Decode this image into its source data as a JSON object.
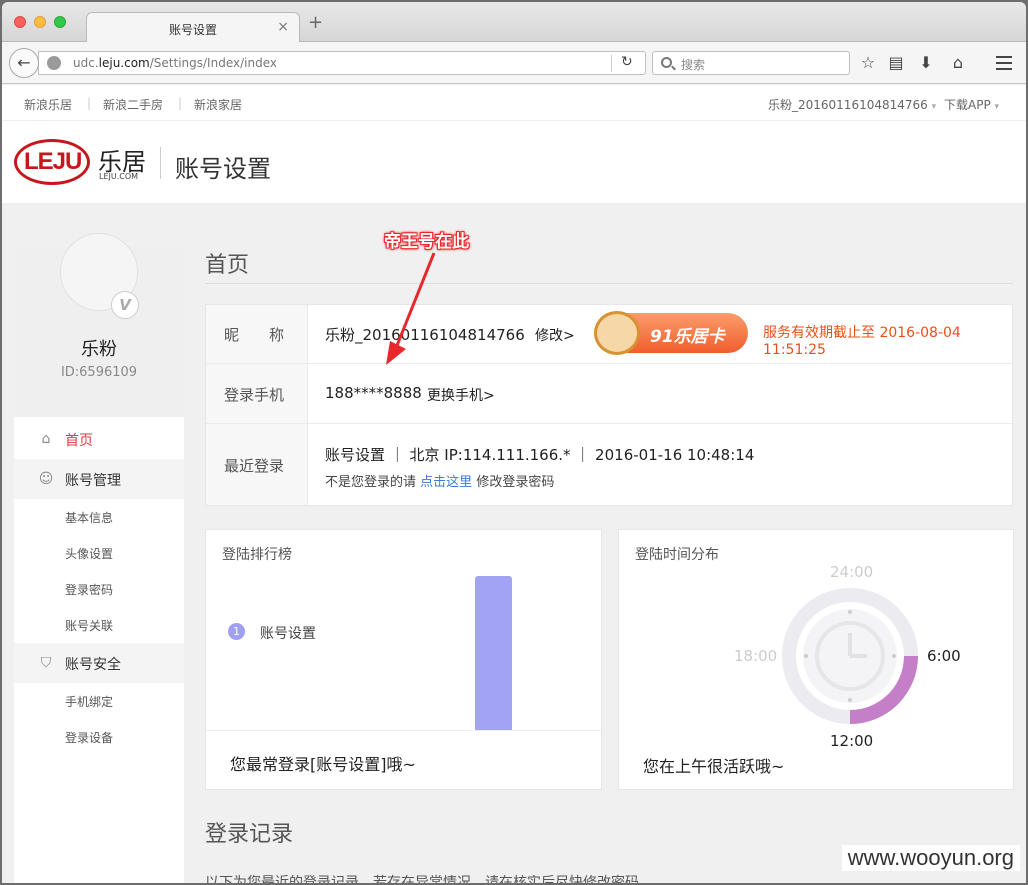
{
  "browser": {
    "tab_title": "账号设置",
    "tab_close": "×",
    "new_tab": "+",
    "url_domain": "udc.",
    "url_bold": "leju.com",
    "url_path": "/Settings/Index/index",
    "search_placeholder": "搜索"
  },
  "topnav": {
    "links": [
      "新浪乐居",
      "新浪二手房",
      "新浪家居"
    ],
    "user": "乐粉_20160116104814766",
    "download": "下载APP"
  },
  "header": {
    "logo_text": "LEJU",
    "logo_cn": "乐居",
    "logo_com": "LEJU.COM",
    "title": "账号设置"
  },
  "profile": {
    "nickname": "乐粉",
    "id": "ID:6596109",
    "badge": "V"
  },
  "sidebar": {
    "home": "首页",
    "account_manage": "账号管理",
    "manage_items": [
      "基本信息",
      "头像设置",
      "登录密码",
      "账号关联"
    ],
    "account_security": "账号安全",
    "security_items": [
      "手机绑定",
      "登录设备"
    ]
  },
  "main": {
    "title": "首页",
    "annotation": "帝王号在此",
    "nickname_key": "昵　　称",
    "nickname_val": "乐粉_20160116104814766",
    "nickname_link": "修改>",
    "vip_text": "91乐居卡",
    "expire": "服务有效期截止至 2016-08-04 11:51:25",
    "phone_key": "登录手机",
    "phone_val": "188****8888",
    "phone_link": "更换手机>",
    "login_key": "最近登录",
    "login_val": "账号设置 ｜ 北京 IP:114.111.166.* ｜ 2016-01-16 10:48:14",
    "login_hint_pre": "不是您登录的请",
    "login_hint_link": "点击这里",
    "login_hint_post": "修改登录密码"
  },
  "rank_card": {
    "title": "登陆排行榜",
    "rank_no": "1",
    "rank_label": "账号设置",
    "footer": "您最常登录[账号设置]哦~"
  },
  "time_card": {
    "title": "登陆时间分布",
    "label_top": "24:00",
    "label_left": "18:00",
    "label_right": "6:00",
    "label_bottom": "12:00",
    "footer": "您在上午很活跃哦~",
    "active_color": "#c47fc8"
  },
  "section2": {
    "title": "登录记录",
    "cut_text": "以下为您最近的登录记录，若存在异常情况，请在核实后尽快修改密码"
  },
  "watermark": "www.wooyun.org",
  "colors": {
    "brand_red": "#c8161d",
    "active_red": "#e4393c",
    "link_blue": "#3a7ad9",
    "expire_orange": "#e8501a",
    "bar_purple": "#a2a3f3"
  }
}
